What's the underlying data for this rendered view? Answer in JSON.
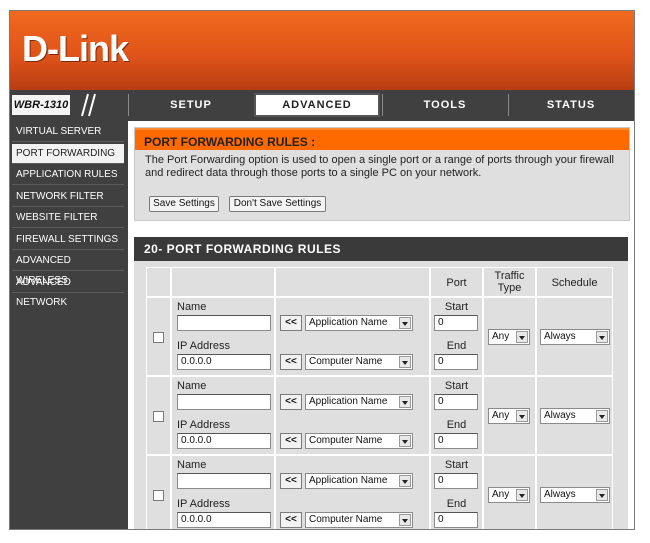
{
  "brand": {
    "logo_text": "D-Link"
  },
  "navbar": {
    "model": "WBR-1310",
    "tabs": [
      {
        "label": "SETUP"
      },
      {
        "label": "ADVANCED"
      },
      {
        "label": "TOOLS"
      },
      {
        "label": "STATUS"
      }
    ],
    "active_tab": "ADVANCED"
  },
  "sidebar": {
    "items": [
      {
        "label": "VIRTUAL SERVER"
      },
      {
        "label": "PORT FORWARDING"
      },
      {
        "label": "APPLICATION RULES"
      },
      {
        "label": "NETWORK FILTER"
      },
      {
        "label": "WEBSITE FILTER"
      },
      {
        "label": "FIREWALL SETTINGS"
      },
      {
        "label": "ADVANCED WIRELESS"
      },
      {
        "label": "ADVANCED NETWORK"
      }
    ],
    "active_item": "PORT FORWARDING"
  },
  "rules_box": {
    "title": "PORT FORWARDING RULES :",
    "description": "The Port Forwarding option is used to open a single port or a range of ports through your firewall and redirect data through those ports to a single PC on your network.",
    "save_label": "Save Settings",
    "dont_save_label": "Don't Save Settings"
  },
  "table": {
    "title": "20- PORT FORWARDING RULES",
    "col_port": "Port",
    "col_traffic": "Traffic Type",
    "col_schedule": "Schedule",
    "name_label": "Name",
    "ip_label": "IP Address",
    "start_label": "Start",
    "end_label": "End",
    "copy_button": "<<",
    "rows": [
      {
        "name_value": "",
        "ip_value": "0.0.0.0",
        "app_select": "Application Name",
        "computer_select": "Computer Name",
        "start": "0",
        "end": "0",
        "traffic": "Any",
        "schedule": "Always",
        "checked": false
      },
      {
        "name_value": "",
        "ip_value": "0.0.0.0",
        "app_select": "Application Name",
        "computer_select": "Computer Name",
        "start": "0",
        "end": "0",
        "traffic": "Any",
        "schedule": "Always",
        "checked": false
      },
      {
        "name_value": "",
        "ip_value": "0.0.0.0",
        "app_select": "Application Name",
        "computer_select": "Computer Name",
        "start": "0",
        "end": "0",
        "traffic": "Any",
        "schedule": "Always",
        "checked": false
      }
    ]
  },
  "colors": {
    "brand_orange": "#e0541a",
    "header_orange": "#ff6a00",
    "dark_bar": "#404040"
  }
}
